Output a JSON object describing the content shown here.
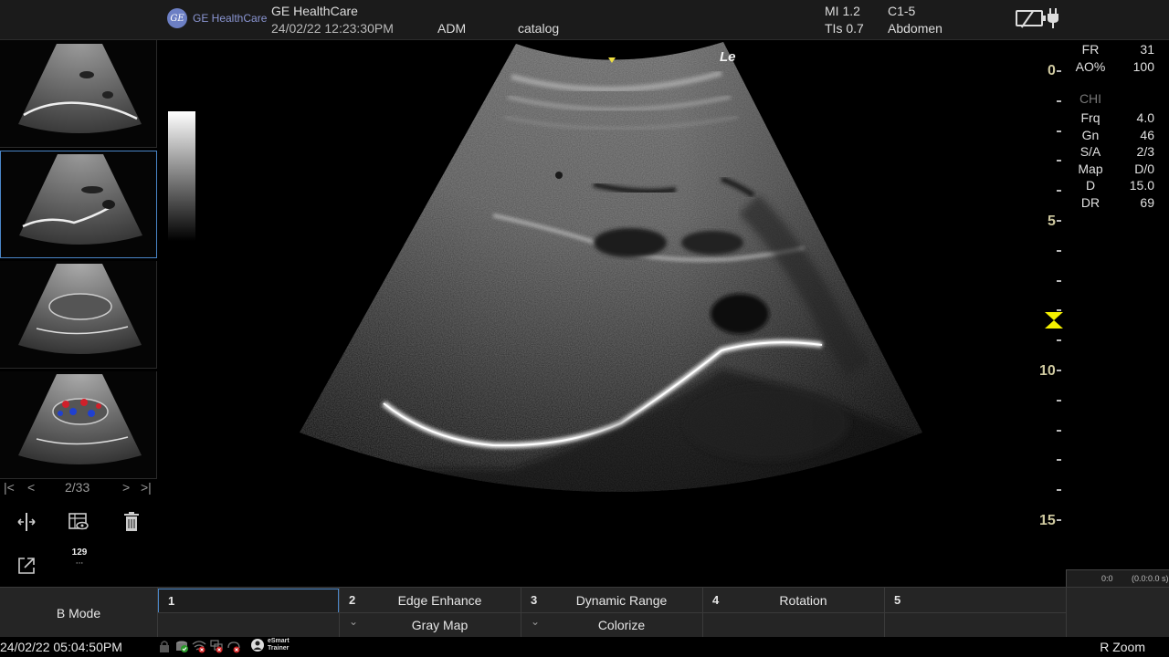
{
  "header": {
    "brand": "GE HealthCare",
    "logo_text": "GE HealthCare",
    "datetime": "24/02/22 12:23:30PM",
    "user": "ADM",
    "preset_name": "catalog",
    "mi": "MI 1.2",
    "tis": "TIs 0.7",
    "probe": "C1-5",
    "exam": "Abdomen"
  },
  "image": {
    "orientation_label": "Le"
  },
  "thumbnails": {
    "count_total": 4,
    "selected_index": 1,
    "pager": {
      "first": "|<",
      "prev": "<",
      "position": "2/33",
      "next": ">",
      "last": ">|"
    }
  },
  "left_tools": {
    "counter_value": "129",
    "counter_sub": "···"
  },
  "depth_scale": {
    "labels": [
      "0",
      "5",
      "10",
      "15"
    ],
    "range_cm": [
      0,
      15
    ],
    "focus_depth_cm": 8
  },
  "params": {
    "top": [
      {
        "key": "FR",
        "value": "31"
      },
      {
        "key": "AO%",
        "value": "100"
      }
    ],
    "mode": "CHI",
    "list": [
      {
        "key": "Frq",
        "value": "4.0"
      },
      {
        "key": "Gn",
        "value": "46"
      },
      {
        "key": "S/A",
        "value": "2/3"
      },
      {
        "key": "Map",
        "value": "D/0"
      },
      {
        "key": "D",
        "value": "15.0"
      },
      {
        "key": "DR",
        "value": "69"
      }
    ]
  },
  "cine": {
    "frame": "0:0",
    "time": "(0.0:0.0 s)"
  },
  "menu": {
    "mode": "B Mode",
    "slots": [
      {
        "num": "1",
        "top": "",
        "bottom": ""
      },
      {
        "num": "2",
        "top": "Edge Enhance",
        "bottom": "Gray Map"
      },
      {
        "num": "3",
        "top": "Dynamic Range",
        "bottom": "Colorize"
      },
      {
        "num": "4",
        "top": "Rotation",
        "bottom": ""
      },
      {
        "num": "5",
        "top": "",
        "bottom": ""
      }
    ],
    "chevron": "⌄"
  },
  "status": {
    "datetime": "24/02/22 05:04:50PM",
    "esmart_line1": "eSmart",
    "esmart_line2": "Trainer",
    "zoom_label": "R Zoom"
  }
}
